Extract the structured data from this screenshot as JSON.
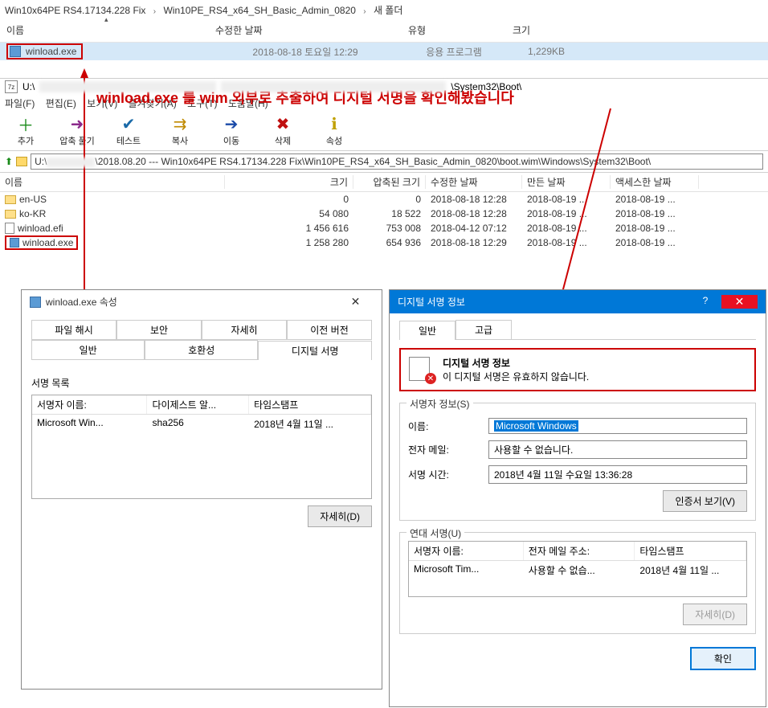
{
  "explorer": {
    "crumb1": "Win10x64PE RS4.17134.228 Fix",
    "crumb2": "Win10PE_RS4_x64_SH_Basic_Admin_0820",
    "crumb3": "새 폴더",
    "cols": {
      "name": "이름",
      "date": "수정한 날짜",
      "type": "유형",
      "size": "크기"
    },
    "row": {
      "name": "winload.exe",
      "date": "2018-08-18 토요일 12:29",
      "type": "응용 프로그램",
      "size": "1,229KB"
    }
  },
  "annotation": "winload.exe 를 wim 외부로 추출하여 디지털 서명을 확인해봤습니다",
  "sevenz": {
    "title_prefix": "U:\\",
    "title_suffix": "\\System32\\Boot\\",
    "menu": [
      "파일(F)",
      "편집(E)",
      "보기(V)",
      "즐겨찾기(A)",
      "도구(T)",
      "도움말(H)"
    ],
    "tools": [
      {
        "l": "추가",
        "c": "#1a8b1a",
        "g": "＋"
      },
      {
        "l": "압축 풀기",
        "c": "#8b2a8b",
        "g": "➜"
      },
      {
        "l": "테스트",
        "c": "#1a6aa8",
        "g": "✔"
      },
      {
        "l": "복사",
        "c": "#c08a00",
        "g": "⇉"
      },
      {
        "l": "이동",
        "c": "#1a4aa8",
        "g": "➔"
      },
      {
        "l": "삭제",
        "c": "#c01010",
        "g": "✖"
      },
      {
        "l": "속성",
        "c": "#c0a000",
        "g": "ℹ"
      }
    ],
    "path_prefix": "U:\\",
    "path_mid": "\\2018.08.20 --- Win10x64PE RS4.17134.228 Fix\\Win10PE_RS4_x64_SH_Basic_Admin_0820\\boot.wim\\Windows\\System32\\Boot\\",
    "cols": {
      "name": "이름",
      "size": "크기",
      "packed": "압축된 크기",
      "mod": "수정한 날짜",
      "created": "만든 날짜",
      "accessed": "액세스한 날짜"
    },
    "rows": [
      {
        "n": "en-US",
        "f": true,
        "s": "0",
        "p": "0",
        "m": "2018-08-18 12:28",
        "c": "2018-08-19 ...",
        "a": "2018-08-19 ..."
      },
      {
        "n": "ko-KR",
        "f": true,
        "s": "54 080",
        "p": "18 522",
        "m": "2018-08-18 12:28",
        "c": "2018-08-19 ...",
        "a": "2018-08-19 ..."
      },
      {
        "n": "winload.efi",
        "f": false,
        "s": "1 456 616",
        "p": "753 008",
        "m": "2018-04-12 07:12",
        "c": "2018-08-19 ...",
        "a": "2018-08-19 ..."
      },
      {
        "n": "winload.exe",
        "f": false,
        "s": "1 258 280",
        "p": "654 936",
        "m": "2018-08-18 12:29",
        "c": "2018-08-19 ...",
        "a": "2018-08-19 ..."
      },
      {
        "red": true
      }
    ]
  },
  "prop": {
    "title": "winload.exe 속성",
    "tabs_top": [
      "파일 해시",
      "보안",
      "자세히",
      "이전 버전"
    ],
    "tabs_bot": [
      "일반",
      "호환성",
      "디지털 서명"
    ],
    "list_label": "서명 목록",
    "th": [
      "서명자 이름:",
      "다이제스트 알...",
      "타임스탬프"
    ],
    "tr": [
      "Microsoft Win...",
      "sha256",
      "2018년 4월 11일 ..."
    ],
    "detail_btn": "자세히(D)"
  },
  "sig": {
    "title": "디지털 서명 정보",
    "tab_general": "일반",
    "tab_adv": "고급",
    "info_title": "디지털 서명 정보",
    "info_msg": "이 디지털 서명은 유효하지 않습니다.",
    "signer_group": "서명자 정보(S)",
    "f_name": "이름:",
    "v_name": "Microsoft Windows",
    "f_mail": "전자 메일:",
    "v_mail": "사용할 수 없습니다.",
    "f_time": "서명 시간:",
    "v_time": "2018년 4월 11일 수요일 13:36:28",
    "cert_btn": "인증서 보기(V)",
    "counter_group": "연대 서명(U)",
    "cth": [
      "서명자 이름:",
      "전자 메일 주소:",
      "타임스탬프"
    ],
    "ctr": [
      "Microsoft Tim...",
      "사용할 수 없습...",
      "2018년 4월 11일 ..."
    ],
    "detail_btn": "자세히(D)",
    "ok_btn": "확인"
  }
}
